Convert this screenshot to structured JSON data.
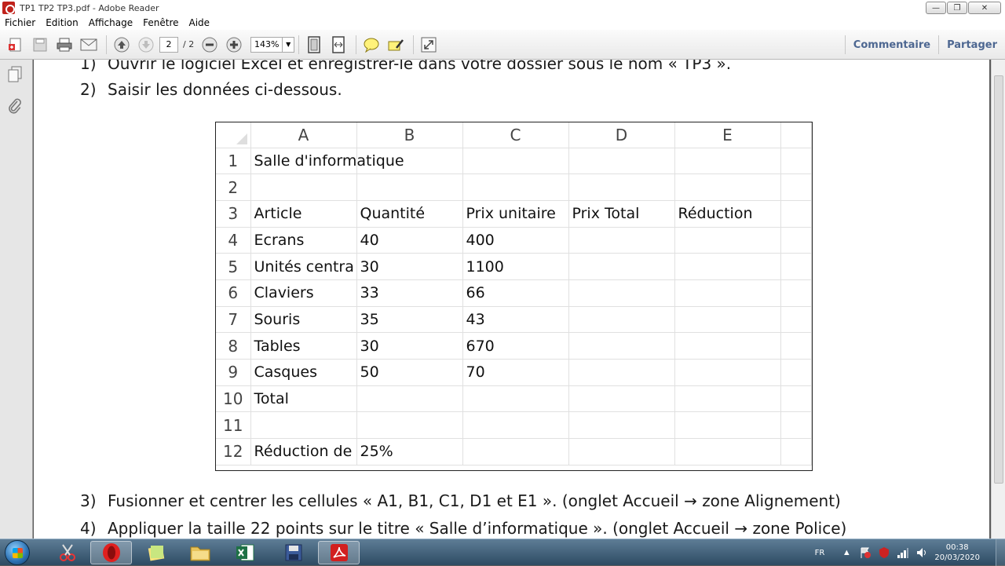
{
  "window": {
    "title": "TP1 TP2 TP3.pdf - Adobe Reader",
    "minimize": "—",
    "maximize": "❐",
    "close": "✕"
  },
  "menu": [
    "Fichier",
    "Edition",
    "Affichage",
    "Fenêtre",
    "Aide"
  ],
  "toolbar": {
    "page_current": "2",
    "page_total": "/ 2",
    "zoom": "143%",
    "comment_label": "Commentaire",
    "share_label": "Partager"
  },
  "document": {
    "step1_num": "1)",
    "step1_text": "Ouvrir le logiciel Excel et enregistrer-le dans votre dossier sous le nom « TP3 ».",
    "step2_num": "2)",
    "step2_text": "Saisir les données ci-dessous.",
    "step3_num": "3)",
    "step3_text": "Fusionner et centrer les cellules « A1, B1, C1, D1 et E1 ». (onglet Accueil → zone Alignement)",
    "step4_num": "4)",
    "step4_text": "Appliquer la taille 22 points sur le titre « Salle d’informatique ». (onglet Accueil → zone Police)"
  },
  "sheet": {
    "columns": [
      "A",
      "B",
      "C",
      "D",
      "E"
    ],
    "rows": [
      {
        "n": "1",
        "cells": [
          "Salle d'informatique",
          "",
          "",
          "",
          ""
        ]
      },
      {
        "n": "2",
        "cells": [
          "",
          "",
          "",
          "",
          ""
        ]
      },
      {
        "n": "3",
        "cells": [
          "Article",
          "Quantité",
          "Prix unitaire",
          "Prix Total",
          "Réduction"
        ]
      },
      {
        "n": "4",
        "cells": [
          "Ecrans",
          "40",
          "400",
          "",
          ""
        ]
      },
      {
        "n": "5",
        "cells": [
          "Unités centra",
          "30",
          "1100",
          "",
          ""
        ]
      },
      {
        "n": "6",
        "cells": [
          "Claviers",
          "33",
          "66",
          "",
          ""
        ]
      },
      {
        "n": "7",
        "cells": [
          "Souris",
          "35",
          "43",
          "",
          ""
        ]
      },
      {
        "n": "8",
        "cells": [
          "Tables",
          "30",
          "670",
          "",
          ""
        ]
      },
      {
        "n": "9",
        "cells": [
          "Casques",
          "50",
          "70",
          "",
          ""
        ]
      },
      {
        "n": "10",
        "cells": [
          "Total",
          "",
          "",
          "",
          ""
        ]
      },
      {
        "n": "11",
        "cells": [
          "",
          "",
          "",
          "",
          ""
        ]
      },
      {
        "n": "12",
        "cells": [
          "Réduction de",
          "25%",
          "",
          "",
          ""
        ]
      }
    ]
  },
  "taskbar": {
    "lang": "FR",
    "time": "00:38",
    "date": "20/03/2020"
  }
}
